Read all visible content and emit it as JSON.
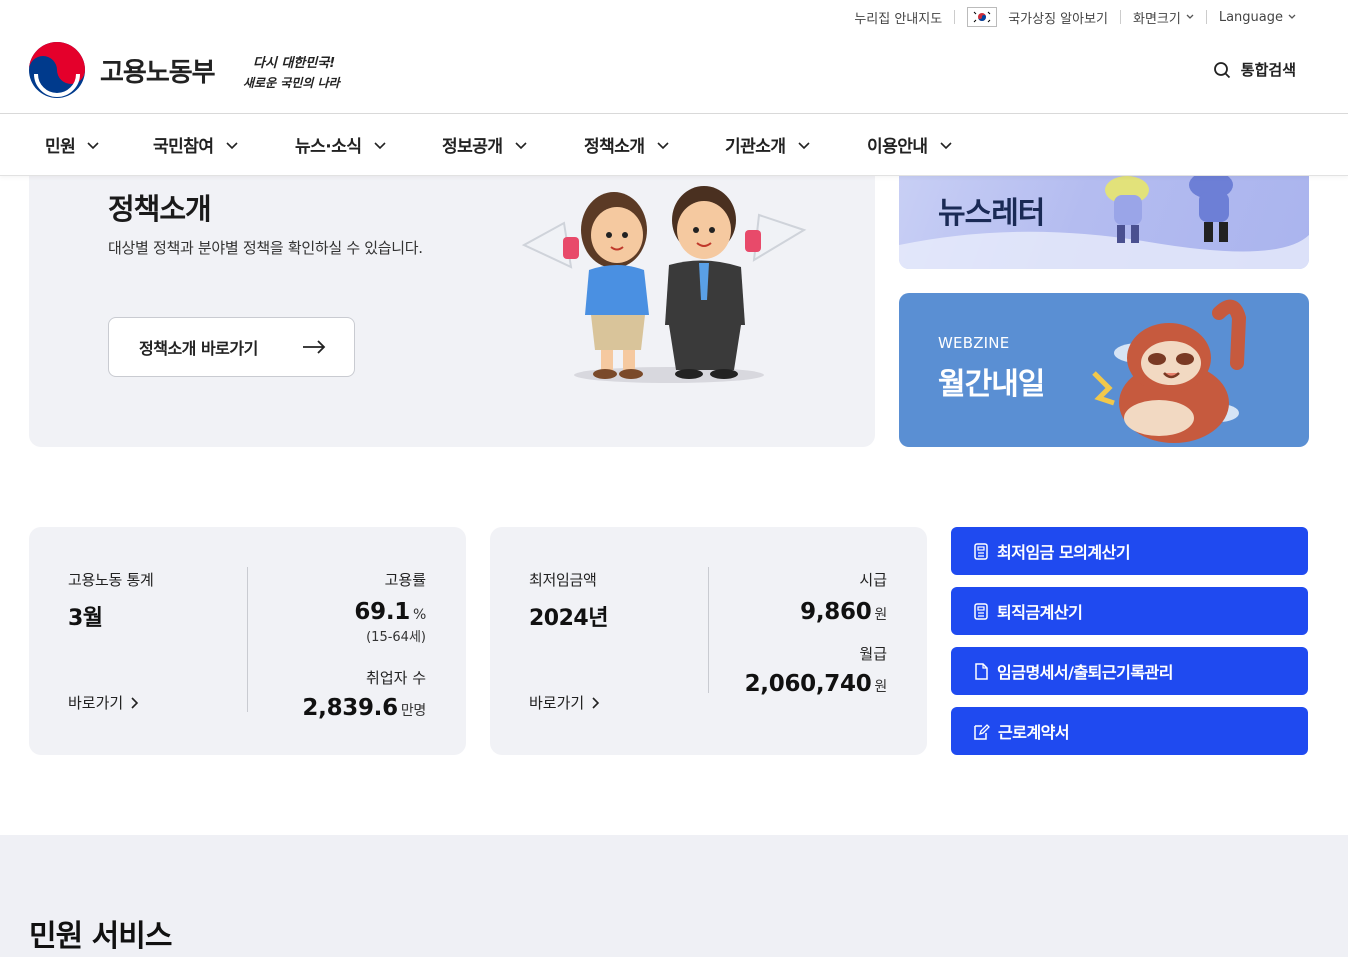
{
  "utility": {
    "sitemap": "누리집 안내지도",
    "national_symbols": "국가상징 알아보기",
    "font_size": "화면크기",
    "language": "Language"
  },
  "brand": {
    "name": "고용노동부",
    "slogan_line1": "다시 대한민국!",
    "slogan_line2": "새로운 국민의 나라"
  },
  "search": {
    "label": "통합검색"
  },
  "nav": {
    "items": [
      {
        "label": "민원"
      },
      {
        "label": "국민참여"
      },
      {
        "label": "뉴스·소식"
      },
      {
        "label": "정보공개"
      },
      {
        "label": "정책소개"
      },
      {
        "label": "기관소개"
      },
      {
        "label": "이용안내"
      }
    ]
  },
  "policy": {
    "title": "정책소개",
    "description": "대상별 정책과 분야별 정책을 확인하실 수 있습니다.",
    "button": "정책소개 바로가기"
  },
  "newsletter": {
    "title": "뉴스레터"
  },
  "webzine": {
    "subtitle": "WEBZINE",
    "title": "월간내일"
  },
  "stats_labor": {
    "label": "고용노동 통계",
    "month": "3월",
    "link": "바로가기",
    "employment_rate_label": "고용률",
    "employment_rate_value": "69.1",
    "employment_rate_unit": "%",
    "employment_rate_note": "(15-64세)",
    "employed_label": "취업자 수",
    "employed_value": "2,839.6",
    "employed_unit": "만명"
  },
  "stats_wage": {
    "label": "최저임금액",
    "year": "2024년",
    "link": "바로가기",
    "hourly_label": "시급",
    "hourly_value": "9,860",
    "hourly_unit": "원",
    "monthly_label": "월급",
    "monthly_value": "2,060,740",
    "monthly_unit": "원"
  },
  "quick_links": [
    {
      "label": "최저임금 모의계산기",
      "icon": "calculator-icon"
    },
    {
      "label": "퇴직금계산기",
      "icon": "calculator-icon"
    },
    {
      "label": "임금명세서/출퇴근기록관리",
      "icon": "document-icon"
    },
    {
      "label": "근로계약서",
      "icon": "contract-edit-icon"
    }
  ],
  "service": {
    "title": "민원 서비스"
  },
  "colors": {
    "accent": "#1f4af0",
    "card_bg": "#f1f2f6",
    "webzine_bg": "#5a8fd3"
  }
}
